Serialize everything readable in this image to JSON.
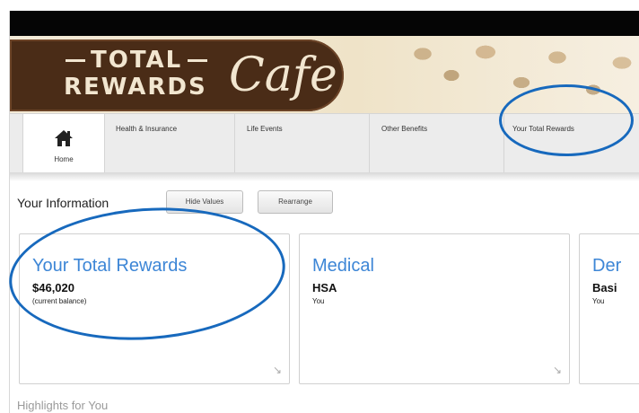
{
  "banner": {
    "logo_line1": "TOTAL",
    "logo_line2": "REWARDS",
    "logo_script": "Cafe"
  },
  "nav": {
    "home_icon": "home-icon",
    "home_label": "Home",
    "tabs": [
      {
        "label": "Health & Insurance"
      },
      {
        "label": "Life Events"
      },
      {
        "label": "Other Benefits"
      },
      {
        "label": "Your Total Rewards"
      }
    ]
  },
  "info": {
    "title": "Your Information",
    "hide_values_label": "Hide Values",
    "rearrange_label": "Rearrange"
  },
  "cards": [
    {
      "title": "Your Total Rewards",
      "value": "$46,020",
      "sub": "(current balance)",
      "expand_icon": "expand-arrow-icon"
    },
    {
      "title": "Medical",
      "value": "HSA",
      "sub": "You",
      "expand_icon": "expand-arrow-icon"
    },
    {
      "title": "Der",
      "value": "Basi",
      "sub": "You"
    }
  ],
  "highlights": {
    "title": "Highlights for You"
  },
  "colors": {
    "accent": "#3d86d6",
    "annotation": "#1769bd",
    "brand_brown": "#4a2c17"
  }
}
